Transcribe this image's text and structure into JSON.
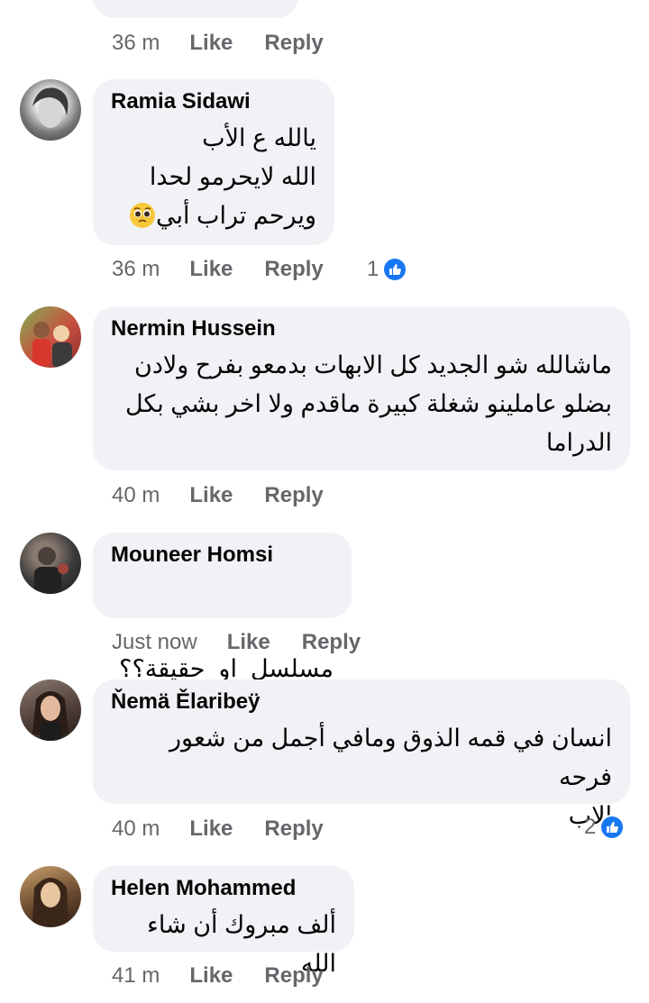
{
  "top_fragment": {
    "actions": {
      "time": "36 m",
      "like": "Like",
      "reply": "Reply"
    }
  },
  "comments": [
    {
      "author": "Ramia Sidawi",
      "lines": [
        "يالله ع الأب",
        "الله لايحرمو لحدا",
        "ويرحم تراب أبي"
      ],
      "emoji": "pleading-face-emoji",
      "actions": {
        "time": "36 m",
        "like": "Like",
        "reply": "Reply"
      },
      "reaction_count": "1",
      "reaction_icon": "like-reaction-icon",
      "avatar_colors": [
        "#cfcfcf",
        "#6b6b6b"
      ]
    },
    {
      "author": "Nermin Hussein",
      "lines": [
        "ماشالله شو الجديد كل الابهات بدمعو بفرح ولادن",
        "بضلو عاملينو شغلة كبيرة ماقدم ولا اخر بشي بكل",
        "الدراما"
      ],
      "actions": {
        "time": "40 m",
        "like": "Like",
        "reply": "Reply"
      },
      "avatar_colors": [
        "#d9534f",
        "#7a9a4a"
      ]
    },
    {
      "author": "Mouneer Homsi",
      "lines": [
        "مسلسل  او  حقيقة؟؟"
      ],
      "actions": {
        "time": "Just now",
        "like": "Like",
        "reply": "Reply"
      },
      "avatar_colors": [
        "#3a3a3a",
        "#8a6f64"
      ]
    },
    {
      "author": "Ňemä Ělaribeÿ",
      "lines": [
        "انسان في قمه الذوق ومافي أجمل من شعور فرحه",
        "الاب"
      ],
      "actions": {
        "time": "40 m",
        "like": "Like",
        "reply": "Reply"
      },
      "reaction_count": "2",
      "reaction_icon": "like-reaction-icon",
      "avatar_colors": [
        "#4a3a33",
        "#c9a48f"
      ]
    },
    {
      "author": "Helen Mohammed",
      "lines": [
        "ألف مبروك أن شاء الله"
      ],
      "actions": {
        "time": "41 m",
        "like": "Like",
        "reply": "Reply"
      },
      "avatar_colors": [
        "#5a3e2b",
        "#d8b98f"
      ]
    }
  ],
  "colors": {
    "bubble": "#f0f2f5",
    "meta_text": "#65676b",
    "like_blue": "#1877f2",
    "text": "#050505"
  }
}
